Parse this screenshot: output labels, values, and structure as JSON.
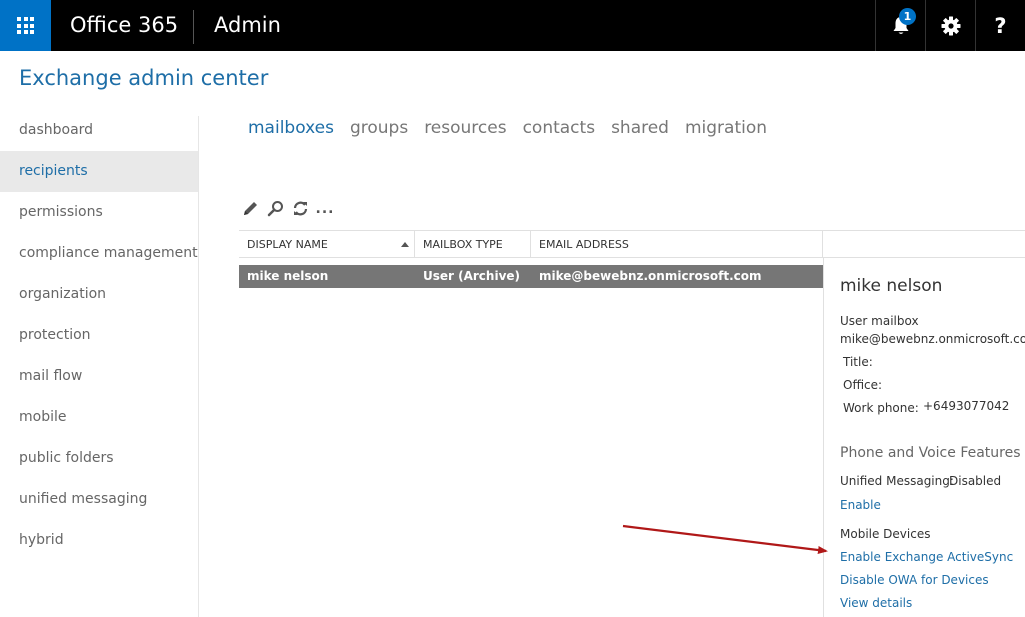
{
  "topbar": {
    "brand": "Office 365",
    "app": "Admin",
    "notification_count": "1",
    "help_label": "?"
  },
  "page": {
    "title": "Exchange admin center"
  },
  "leftnav": {
    "items": [
      {
        "label": "dashboard",
        "active": false
      },
      {
        "label": "recipients",
        "active": true
      },
      {
        "label": "permissions",
        "active": false
      },
      {
        "label": "compliance management",
        "active": false
      },
      {
        "label": "organization",
        "active": false
      },
      {
        "label": "protection",
        "active": false
      },
      {
        "label": "mail flow",
        "active": false
      },
      {
        "label": "mobile",
        "active": false
      },
      {
        "label": "public folders",
        "active": false
      },
      {
        "label": "unified messaging",
        "active": false
      },
      {
        "label": "hybrid",
        "active": false
      }
    ]
  },
  "tabs": [
    {
      "label": "mailboxes",
      "active": true
    },
    {
      "label": "groups",
      "active": false
    },
    {
      "label": "resources",
      "active": false
    },
    {
      "label": "contacts",
      "active": false
    },
    {
      "label": "shared",
      "active": false
    },
    {
      "label": "migration",
      "active": false
    }
  ],
  "toolbar": {
    "icons": [
      "edit-icon",
      "search-icon",
      "refresh-icon",
      "more-icon"
    ],
    "more_label": "..."
  },
  "table": {
    "columns": [
      "DISPLAY NAME",
      "MAILBOX TYPE",
      "EMAIL ADDRESS"
    ],
    "rows": [
      {
        "display_name": "mike nelson",
        "mailbox_type": "User (Archive)",
        "email": "mike@bewebnz.onmicrosoft.com"
      }
    ]
  },
  "details": {
    "name": "mike nelson",
    "type": "User mailbox",
    "email": "mike@bewebnz.onmicrosoft.com",
    "title_label": "Title:",
    "office_label": "Office:",
    "work_phone_label": "Work phone:",
    "work_phone": "+6493077042",
    "phone_voice_heading": "Phone and Voice Features",
    "um_label": "Unified Messaging:",
    "um_value": "Disabled",
    "enable_link": "Enable",
    "mobile_heading": "Mobile Devices",
    "enable_eas_link": "Enable Exchange ActiveSync",
    "disable_owa_link": "Disable OWA for Devices",
    "view_details_link": "View details"
  },
  "colors": {
    "accent": "#1e6ea7",
    "waffle_bg": "#0072c6",
    "selected_row": "#767676",
    "annotation_arrow": "#b01818"
  }
}
